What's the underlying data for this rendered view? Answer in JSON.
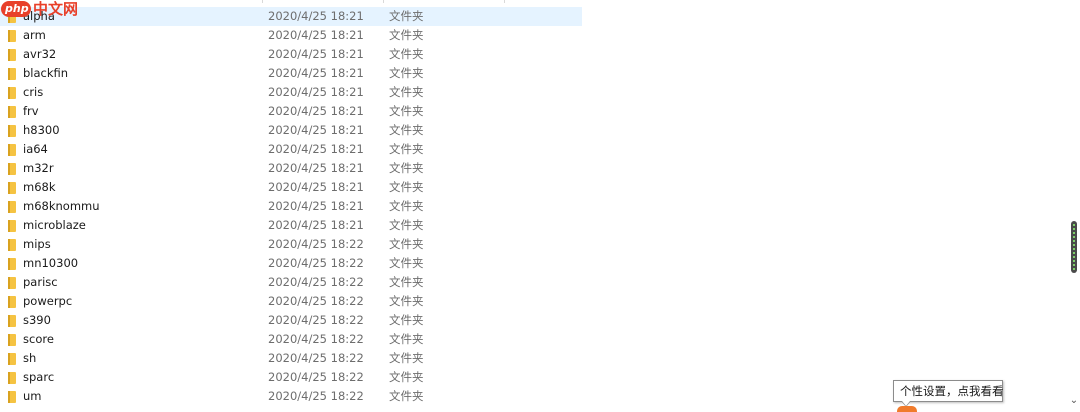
{
  "watermark": {
    "logo_text": "php",
    "site_text": "中文网"
  },
  "colors": {
    "selection": "#e5f3ff",
    "folder": "#f5c342",
    "accent": "#e8402a"
  },
  "file_list": {
    "rows": [
      {
        "name": "alpha",
        "modified": "2020/4/25 18:21",
        "type": "文件夹",
        "icon": "folder-icon",
        "selected": true
      },
      {
        "name": "arm",
        "modified": "2020/4/25 18:21",
        "type": "文件夹",
        "icon": "folder-icon"
      },
      {
        "name": "avr32",
        "modified": "2020/4/25 18:21",
        "type": "文件夹",
        "icon": "folder-icon"
      },
      {
        "name": "blackfin",
        "modified": "2020/4/25 18:21",
        "type": "文件夹",
        "icon": "folder-icon"
      },
      {
        "name": "cris",
        "modified": "2020/4/25 18:21",
        "type": "文件夹",
        "icon": "folder-icon"
      },
      {
        "name": "frv",
        "modified": "2020/4/25 18:21",
        "type": "文件夹",
        "icon": "folder-icon"
      },
      {
        "name": "h8300",
        "modified": "2020/4/25 18:21",
        "type": "文件夹",
        "icon": "folder-icon"
      },
      {
        "name": "ia64",
        "modified": "2020/4/25 18:21",
        "type": "文件夹",
        "icon": "folder-icon"
      },
      {
        "name": "m32r",
        "modified": "2020/4/25 18:21",
        "type": "文件夹",
        "icon": "folder-icon"
      },
      {
        "name": "m68k",
        "modified": "2020/4/25 18:21",
        "type": "文件夹",
        "icon": "folder-icon"
      },
      {
        "name": "m68knommu",
        "modified": "2020/4/25 18:21",
        "type": "文件夹",
        "icon": "folder-icon"
      },
      {
        "name": "microblaze",
        "modified": "2020/4/25 18:21",
        "type": "文件夹",
        "icon": "folder-icon"
      },
      {
        "name": "mips",
        "modified": "2020/4/25 18:22",
        "type": "文件夹",
        "icon": "folder-icon"
      },
      {
        "name": "mn10300",
        "modified": "2020/4/25 18:22",
        "type": "文件夹",
        "icon": "folder-icon"
      },
      {
        "name": "parisc",
        "modified": "2020/4/25 18:22",
        "type": "文件夹",
        "icon": "folder-icon"
      },
      {
        "name": "powerpc",
        "modified": "2020/4/25 18:22",
        "type": "文件夹",
        "icon": "folder-icon"
      },
      {
        "name": "s390",
        "modified": "2020/4/25 18:22",
        "type": "文件夹",
        "icon": "folder-icon"
      },
      {
        "name": "score",
        "modified": "2020/4/25 18:22",
        "type": "文件夹",
        "icon": "folder-icon"
      },
      {
        "name": "sh",
        "modified": "2020/4/25 18:22",
        "type": "文件夹",
        "icon": "folder-icon"
      },
      {
        "name": "sparc",
        "modified": "2020/4/25 18:22",
        "type": "文件夹",
        "icon": "folder-icon"
      },
      {
        "name": "um",
        "modified": "2020/4/25 18:22",
        "type": "文件夹",
        "icon": "folder-icon"
      }
    ]
  },
  "tooltip": {
    "text": "个性设置，点我看看"
  },
  "scrollbar": {
    "down_glyph": "⌄",
    "position": 0.55
  }
}
